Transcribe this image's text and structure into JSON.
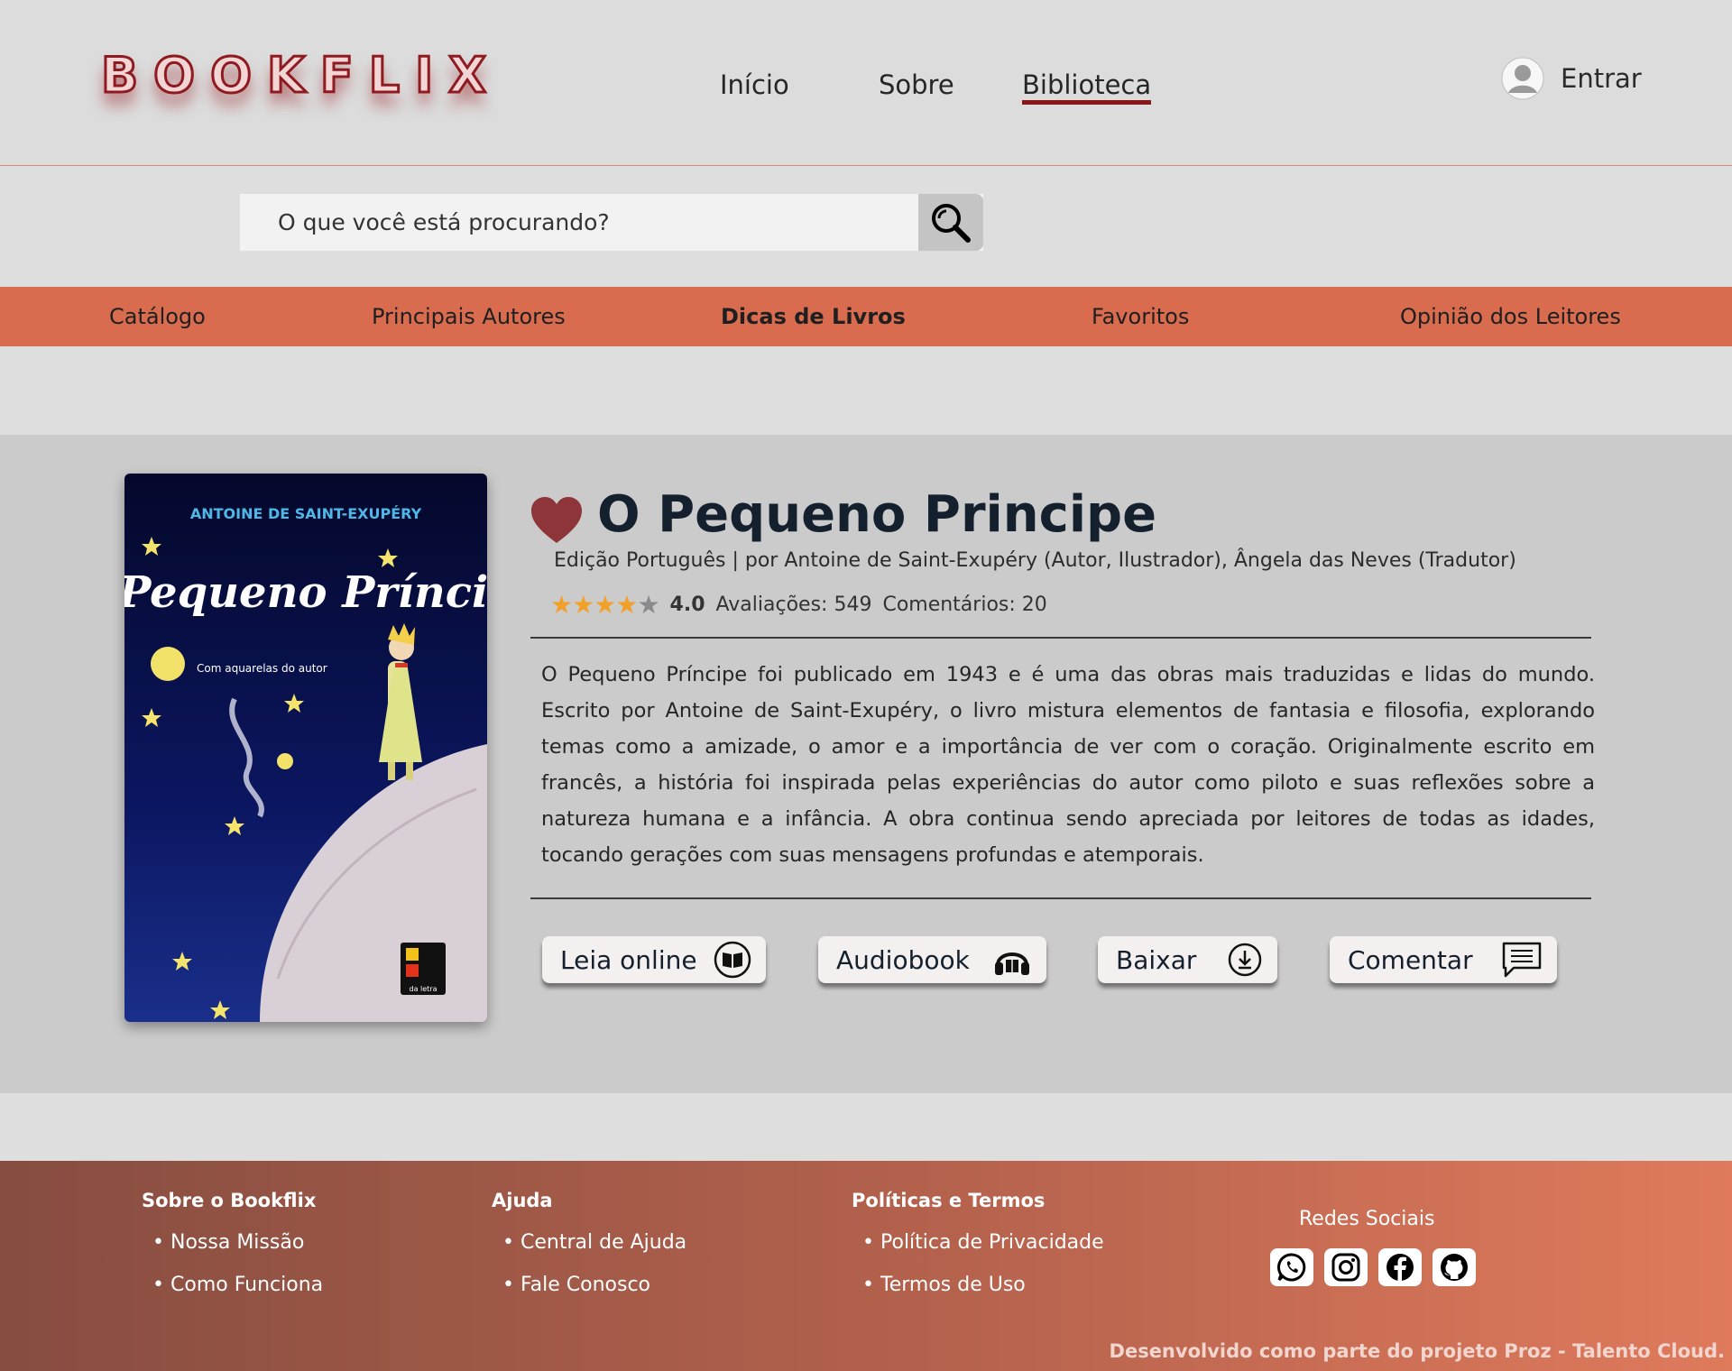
{
  "brand": {
    "logo_text": "BOOKFLIX",
    "accent": "#8b161a",
    "category_bar": "#d96c4f"
  },
  "nav": {
    "items": [
      {
        "label": "Início",
        "active": false
      },
      {
        "label": "Sobre",
        "active": false
      },
      {
        "label": "Biblioteca",
        "active": true
      }
    ],
    "login_label": "Entrar",
    "login_icon": "user-avatar-icon"
  },
  "search": {
    "placeholder": "O que você está procurando?",
    "value": "",
    "icon": "search-icon"
  },
  "categories": [
    {
      "label": "Catálogo",
      "bold": false
    },
    {
      "label": "Principais Autores",
      "bold": false
    },
    {
      "label": "Dicas de Livros",
      "bold": true
    },
    {
      "label": "Favoritos",
      "bold": false
    },
    {
      "label": "Opinião dos Leitores",
      "bold": false
    }
  ],
  "book": {
    "cover": {
      "author": "ANTOINE DE SAINT-EXUPÉRY",
      "title": "O Pequeno Príncipe",
      "subtitle": "Com aquarelas do autor",
      "publisher": "da letra"
    },
    "favorite_icon": "heart-icon",
    "title": "O Pequeno Principe",
    "meta": "Edição Português  |  por Antoine de Saint-Exupéry (Autor, Ilustrador), Ângela das Neves (Tradutor)",
    "rating": {
      "stars": 4,
      "max": 5,
      "score": "4.0",
      "reviews": "Avaliações: 549",
      "comments": "Comentários: 20"
    },
    "description": "O Pequeno Príncipe foi publicado em 1943 e é uma das obras mais traduzidas e lidas do mundo. Escrito por Antoine de Saint-Exupéry, o livro mistura elementos de fantasia e filosofia, explorando temas como a amizade, o amor e a importância de ver com o coração. Originalmente escrito em francês, a história foi inspirada pelas experiências do autor como piloto e suas reflexões sobre a natureza humana e a infância. A obra continua sendo apreciada por leitores de todas as idades, tocando gerações com suas mensagens profundas e atemporais."
  },
  "actions": [
    {
      "label": "Leia online",
      "icon": "book-icon"
    },
    {
      "label": "Audiobook",
      "icon": "headphones-icon"
    },
    {
      "label": "Baixar",
      "icon": "download-icon"
    },
    {
      "label": "Comentar",
      "icon": "comment-icon"
    }
  ],
  "footer": {
    "columns": [
      {
        "title": "Sobre o Bookflix",
        "links": [
          "Nossa Missão",
          "Como Funciona"
        ]
      },
      {
        "title": "Ajuda",
        "links": [
          "Central de Ajuda",
          "Fale Conosco"
        ]
      },
      {
        "title": "Políticas e Termos",
        "links": [
          "Política de Privacidade",
          "Termos de Uso"
        ]
      }
    ],
    "social_title": "Redes Sociais",
    "social_icons": [
      "whatsapp-icon",
      "instagram-icon",
      "facebook-icon",
      "github-icon"
    ],
    "credit": "Desenvolvido como parte do projeto Proz - Talento Cloud."
  }
}
